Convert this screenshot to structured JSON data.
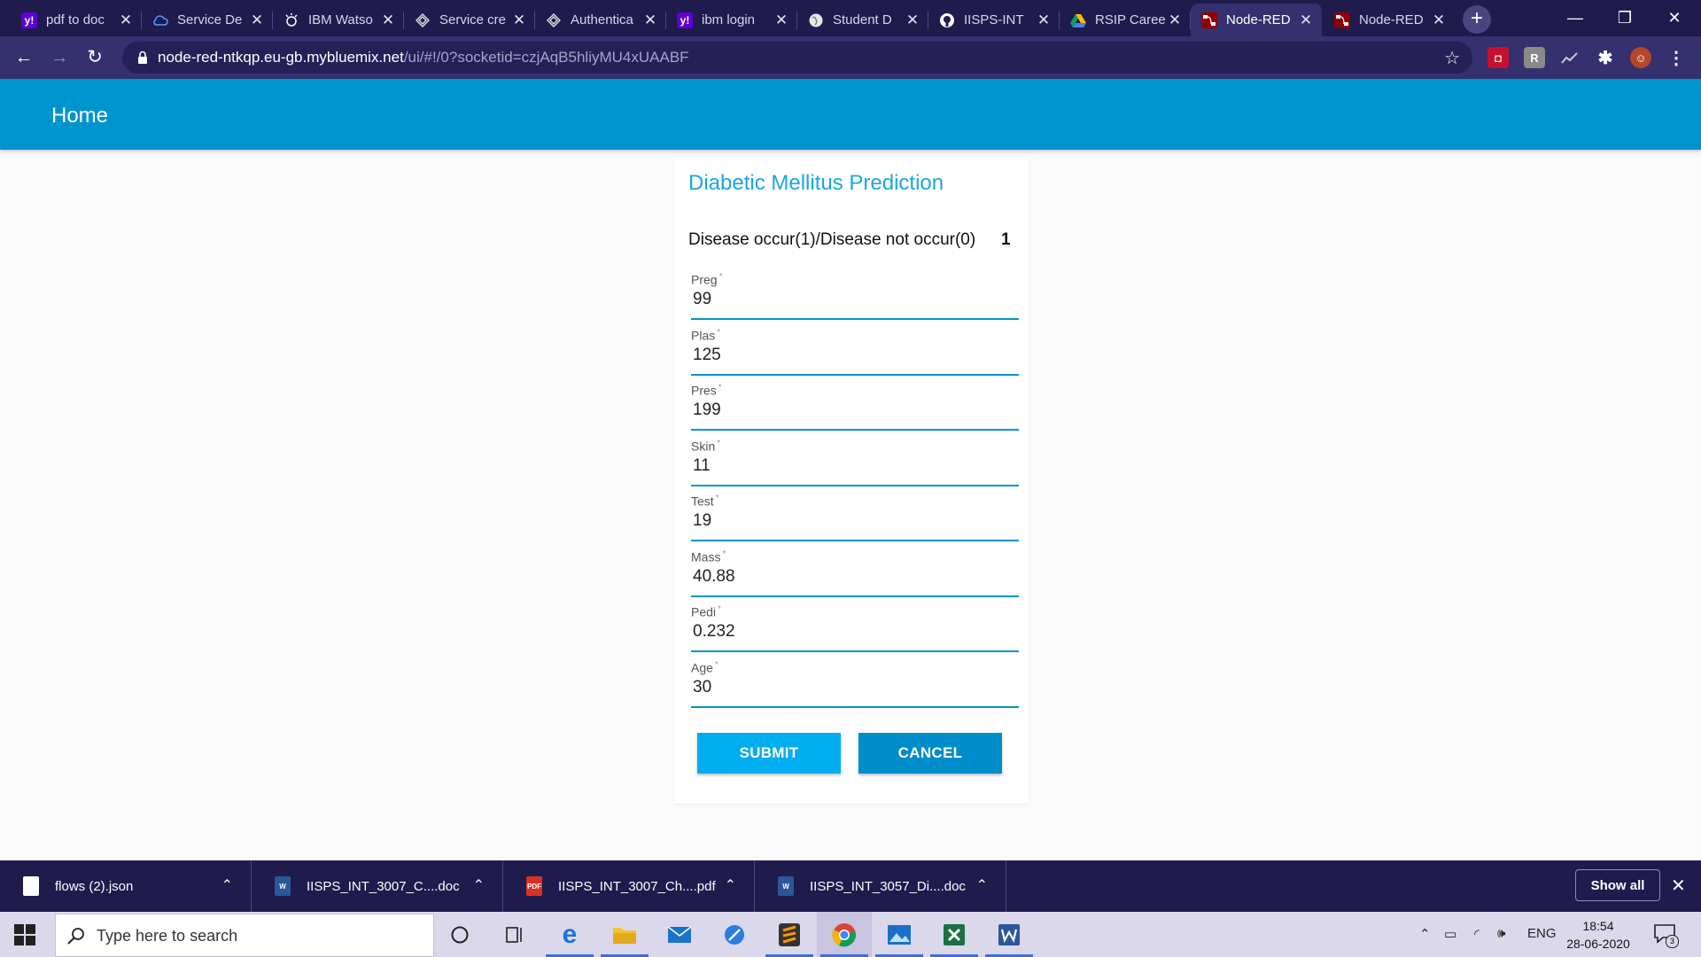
{
  "browser": {
    "tabs": [
      {
        "title": "pdf to doc",
        "icon": "yahoo-icon",
        "active": false
      },
      {
        "title": "Service De",
        "icon": "cloud-icon",
        "active": false
      },
      {
        "title": "IBM Watso",
        "icon": "watson-icon",
        "active": false
      },
      {
        "title": "Service cre",
        "icon": "ibm-cloud-icon",
        "active": false
      },
      {
        "title": "Authentica",
        "icon": "ibm-cloud-icon",
        "active": false
      },
      {
        "title": "ibm login",
        "icon": "yahoo-icon",
        "active": false
      },
      {
        "title": "Student D",
        "icon": "globe-icon",
        "active": false
      },
      {
        "title": "IISPS-INT",
        "icon": "github-icon",
        "active": false
      },
      {
        "title": "RSIP Caree",
        "icon": "drive-icon",
        "active": false
      },
      {
        "title": "Node-RED",
        "icon": "node-red-icon",
        "active": true
      },
      {
        "title": "Node-RED",
        "icon": "node-red-icon",
        "active": false
      }
    ],
    "url_host": "node-red-ntkqp.eu-gb.mybluemix.net",
    "url_path": "/ui/#!/0?socketid=czjAqB5hliyMU4xUAABF"
  },
  "app": {
    "header_title": "Home",
    "form": {
      "title": "Diabetic Mellitus Prediction",
      "result_label": "Disease occur(1)/Disease not occur(0)",
      "result_value": "1",
      "required_mark": "*",
      "fields": [
        {
          "label": "Preg",
          "value": "99"
        },
        {
          "label": "Plas",
          "value": "125"
        },
        {
          "label": "Pres",
          "value": "199"
        },
        {
          "label": "Skin",
          "value": "11"
        },
        {
          "label": "Test",
          "value": "19"
        },
        {
          "label": "Mass",
          "value": "40.88"
        },
        {
          "label": "Pedi",
          "value": "0.232"
        },
        {
          "label": "Age",
          "value": "30"
        }
      ],
      "submit_label": "SUBMIT",
      "cancel_label": "CANCEL"
    }
  },
  "downloads": {
    "items": [
      {
        "name": "flows (2).json",
        "type": "json"
      },
      {
        "name": "IISPS_INT_3007_C....doc",
        "type": "word"
      },
      {
        "name": "IISPS_INT_3007_Ch....pdf",
        "type": "pdf"
      },
      {
        "name": "IISPS_INT_3057_Di....doc",
        "type": "word"
      }
    ],
    "show_all_label": "Show all"
  },
  "taskbar": {
    "search_placeholder": "Type here to search",
    "language": "ENG",
    "time": "18:54",
    "date": "28-06-2020",
    "notification_count": "3"
  },
  "colors": {
    "header": "#0094ce",
    "title": "#1ba6e0",
    "submit": "#00adef",
    "cancel": "#008dcb"
  }
}
